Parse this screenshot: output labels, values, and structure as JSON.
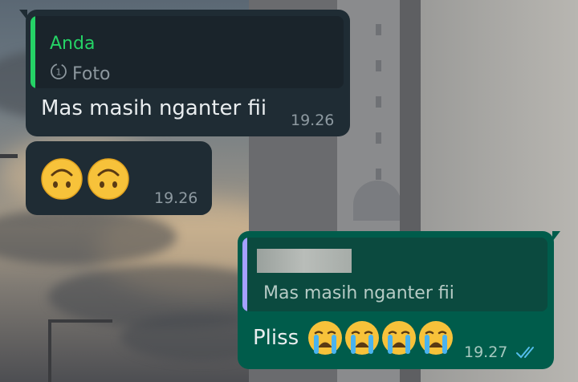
{
  "messages": {
    "incoming_1": {
      "reply_author": "Anda",
      "reply_media_icon": "view-once-icon",
      "reply_label": "Foto",
      "text": "Mas masih nganter fii",
      "time": "19.26"
    },
    "incoming_2": {
      "emoji_icons": [
        "upside-down-face-icon",
        "upside-down-face-icon"
      ],
      "time": "19.26"
    },
    "outgoing_1": {
      "reply_author_redacted": true,
      "reply_text": "Mas masih nganter fii",
      "text": "Pliss",
      "emoji_icons": [
        "crying-face-icon",
        "crying-face-icon",
        "crying-face-icon",
        "crying-face-icon"
      ],
      "time": "19.27",
      "status_icon": "double-check-read-icon"
    }
  },
  "colors": {
    "incoming_bubble": "#1f2c34",
    "outgoing_bubble": "#005c4b",
    "reply_author_green": "#25d366",
    "read_ticks": "#53bdeb"
  }
}
